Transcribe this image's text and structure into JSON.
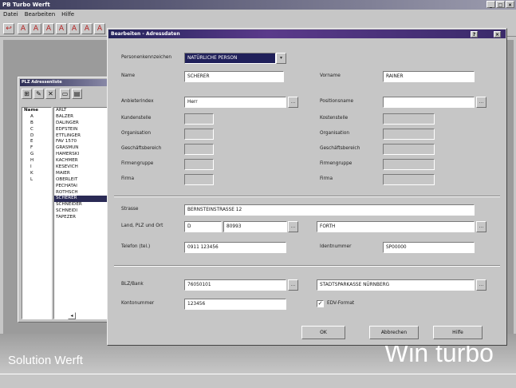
{
  "app": {
    "title": "PB Turbo Werft",
    "menu": [
      "Datei",
      "Bearbeiten",
      "Hilfe"
    ],
    "brand_left": "Solution Werft",
    "brand_right": "Win turbo"
  },
  "list_window": {
    "title": "PLZ Adressenliste",
    "header": "Name",
    "letters": [
      "A",
      "B",
      "C",
      "D",
      "E",
      "F",
      "G",
      "H",
      "I",
      "K",
      "L"
    ],
    "names": [
      "ARLT",
      "BALZER",
      "DALINGER",
      "EDFSTEIN",
      "ETTLINGER",
      "FAV 1570",
      "GRASMUN",
      "HAMERSKI",
      "KACHMER",
      "KESEVICH",
      "MAIER",
      "OBERLEIT",
      "PECHATAI",
      "ROTHSCH",
      "SCHERER",
      "SCHNEIDER",
      "SCHNEIDI",
      "TAPEZER"
    ],
    "selected_index": 14
  },
  "dialog": {
    "title": "Bearbeiten - Adressdaten",
    "fields": {
      "person_type_label": "Personenkennzeichen",
      "person_type_value": "NATÜRLICHE PERSON",
      "name_label": "Name",
      "name_value": "SCHERER",
      "firstname_label": "Vorname",
      "firstname_value": "RAINER",
      "salutation_label": "Anbieterindex",
      "salutation_value": "Herr",
      "position_label": "Positionsname",
      "position_value": "",
      "customer_label": "Kundenstelle",
      "customer_value": "",
      "cost_center_label": "Kostenstelle",
      "cost_center_value": "",
      "org_label": "Organisation",
      "org_value": "",
      "org2_label": "Organisation",
      "org2_value": "",
      "area_label": "Geschäftsbereich",
      "area_value": "",
      "area2_label": "Geschäftsbereich",
      "area2_value": "",
      "group_label": "Firmengruppe",
      "group_value": "",
      "group2_label": "Firmengruppe",
      "group2_value": "",
      "company_label": "Firma",
      "company_value": "",
      "company2_label": "Firma",
      "company2_value": "",
      "street_label": "Strasse",
      "street_value": "BERNSTEINSTRASSE 12",
      "country_label": "Land, PLZ und Ort",
      "country_value": "D",
      "zip_value": "80993",
      "city_value": "FORTH",
      "phone_label": "Telefon (tel.)",
      "phone_value": "0911 123456",
      "ident_label": "Identnummer",
      "ident_value": "SP00000",
      "bank_label": "BLZ/Bank",
      "bank_code_value": "76050101",
      "bank_name_value": "STADTSPARKASSE NÜRNBERG",
      "account_label": "Kontonummer",
      "account_value": "123456",
      "checkbox_label": "EDV-Format",
      "checkbox_checked": true
    },
    "buttons": {
      "ok": "OK",
      "cancel": "Abbrechen",
      "help": "Hilfe"
    }
  }
}
